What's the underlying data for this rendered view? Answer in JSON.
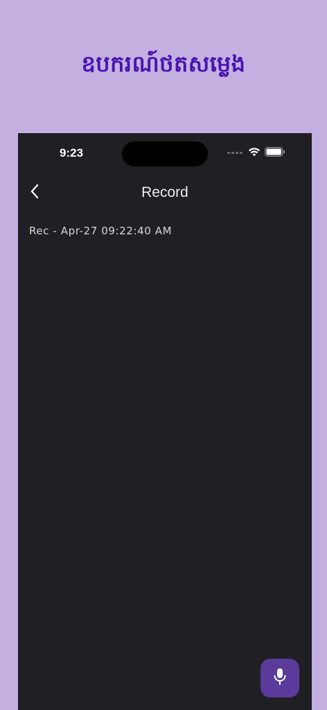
{
  "app": {
    "headline": "ឧបករណ៍ថតសម្លេង"
  },
  "status_bar": {
    "time": "9:23",
    "icons": [
      "signal-icon",
      "wifi-icon",
      "battery-icon"
    ]
  },
  "nav": {
    "back_icon": "chevron-left-icon",
    "title": "Record"
  },
  "recordings": [
    {
      "label": "Rec - Apr-27 09:22:40 AM"
    }
  ],
  "fab": {
    "icon": "microphone-icon"
  },
  "colors": {
    "page_background": "#c3b0e0",
    "headline": "#4a13b0",
    "screen_background": "#1f1f24",
    "fab_background": "#5a3a9a"
  }
}
